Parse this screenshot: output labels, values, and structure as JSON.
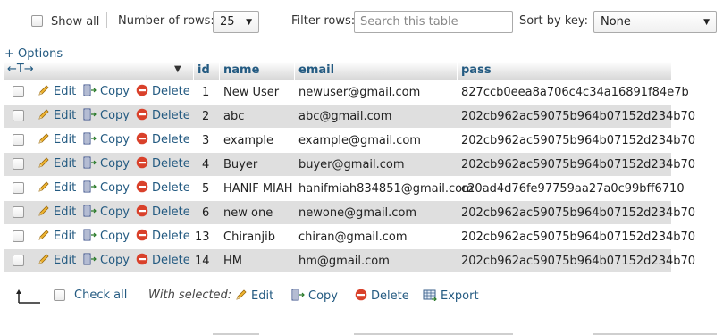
{
  "controls": {
    "show_all_label": "Show all",
    "rows_label": "Number of rows:",
    "rows_value": "25",
    "filter_label": "Filter rows:",
    "filter_placeholder": "Search this table",
    "sort_label": "Sort by key:",
    "sort_value": "None"
  },
  "options_link": "+ Options",
  "table": {
    "columns": [
      "id",
      "name",
      "email",
      "pass"
    ],
    "actions": {
      "edit": "Edit",
      "copy": "Copy",
      "delete": "Delete"
    },
    "rows": [
      {
        "id": "1",
        "name": "New User",
        "email": "newuser@gmail.com",
        "pass": "827ccb0eea8a706c4c34a16891f84e7b"
      },
      {
        "id": "2",
        "name": "abc",
        "email": "abc@gmail.com",
        "pass": "202cb962ac59075b964b07152d234b70"
      },
      {
        "id": "3",
        "name": "example",
        "email": "example@gmail.com",
        "pass": "202cb962ac59075b964b07152d234b70"
      },
      {
        "id": "4",
        "name": "Buyer",
        "email": "buyer@gmail.com",
        "pass": "202cb962ac59075b964b07152d234b70"
      },
      {
        "id": "5",
        "name": "HANIF MIAH",
        "email": "hanifmiah834851@gmail.com",
        "pass": "c20ad4d76fe97759aa27a0c99bff6710"
      },
      {
        "id": "6",
        "name": "new one",
        "email": "newone@gmail.com",
        "pass": "202cb962ac59075b964b07152d234b70"
      },
      {
        "id": "13",
        "name": "Chiranjib",
        "email": "chiran@gmail.com",
        "pass": "202cb962ac59075b964b07152d234b70"
      },
      {
        "id": "14",
        "name": "HM",
        "email": "hm@gmail.com",
        "pass": "202cb962ac59075b964b07152d234b70"
      }
    ]
  },
  "footer": {
    "check_all": "Check all",
    "with_selected": "With selected:",
    "edit": "Edit",
    "copy": "Copy",
    "delete": "Delete",
    "export": "Export"
  },
  "colors": {
    "link": "#235a81",
    "row_alt": "#dfdfdf",
    "delete_icon": "#d9412b"
  }
}
